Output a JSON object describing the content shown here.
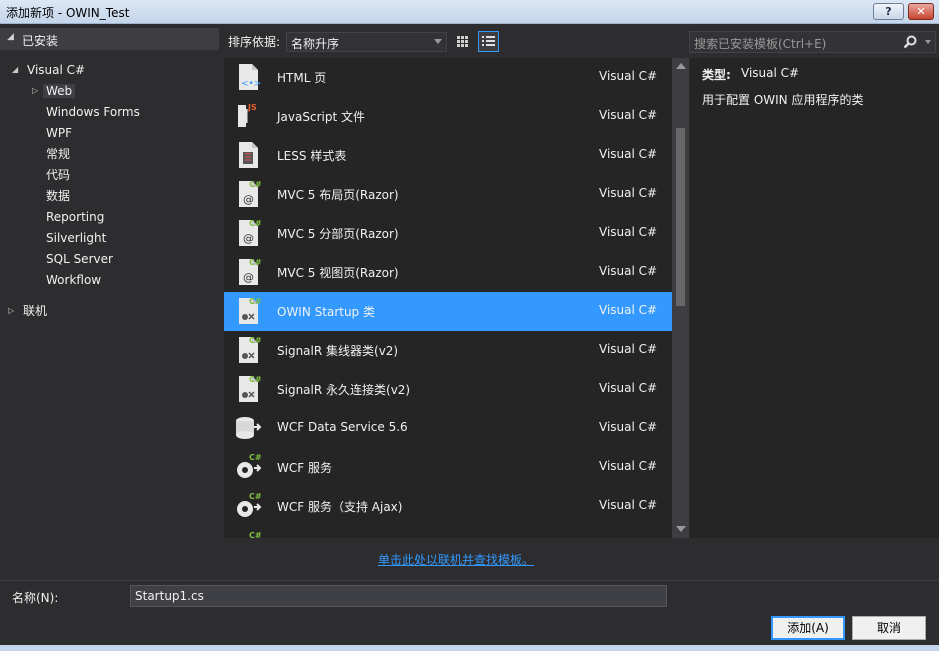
{
  "window": {
    "title": "添加新项 - OWIN_Test",
    "help_label": "?",
    "close_label": "✕"
  },
  "left_panel": {
    "installed_label": "已安装",
    "root_item": "Visual C#",
    "children": [
      "Web",
      "Windows Forms",
      "WPF",
      "常规",
      "代码",
      "数据",
      "Reporting",
      "Silverlight",
      "SQL Server",
      "Workflow"
    ],
    "online_label": "联机"
  },
  "toolbar": {
    "sort_label": "排序依据:",
    "sort_value": "名称升序",
    "search_placeholder": "搜索已安装模板(Ctrl+E)"
  },
  "items": [
    {
      "name": "HTML 页",
      "lang": "Visual C#",
      "icon": "html-page-icon"
    },
    {
      "name": "JavaScript 文件",
      "lang": "Visual C#",
      "icon": "javascript-file-icon"
    },
    {
      "name": "LESS 样式表",
      "lang": "Visual C#",
      "icon": "less-stylesheet-icon"
    },
    {
      "name": "MVC 5 布局页(Razor)",
      "lang": "Visual C#",
      "icon": "razor-page-icon"
    },
    {
      "name": "MVC 5 分部页(Razor)",
      "lang": "Visual C#",
      "icon": "razor-page-icon"
    },
    {
      "name": "MVC 5 视图页(Razor)",
      "lang": "Visual C#",
      "icon": "razor-page-icon"
    },
    {
      "name": "OWIN Startup 类",
      "lang": "Visual C#",
      "icon": "owin-class-icon"
    },
    {
      "name": "SignalR 集线器类(v2)",
      "lang": "Visual C#",
      "icon": "signalr-class-icon"
    },
    {
      "name": "SignalR 永久连接类(v2)",
      "lang": "Visual C#",
      "icon": "signalr-class-icon"
    },
    {
      "name": "WCF Data Service 5.6",
      "lang": "Visual C#",
      "icon": "data-service-icon"
    },
    {
      "name": "WCF 服务",
      "lang": "Visual C#",
      "icon": "wcf-service-icon"
    },
    {
      "name": "WCF 服务（支持 Ajax)",
      "lang": "Visual C#",
      "icon": "wcf-service-icon"
    }
  ],
  "selected_index": 6,
  "details": {
    "type_key": "类型:",
    "type_value": "Visual C#",
    "description": "用于配置 OWIN 应用程序的类"
  },
  "online_link": "单击此处以联机并查找模板。",
  "bottom": {
    "name_label": "名称(N):",
    "name_value": "Startup1.cs",
    "add_label": "添加(A)",
    "cancel_label": "取消"
  },
  "colors": {
    "background": "#2d2d30",
    "list_background": "#252526",
    "selection": "#3399ff",
    "csharp_badge": "#7fbf3f"
  }
}
